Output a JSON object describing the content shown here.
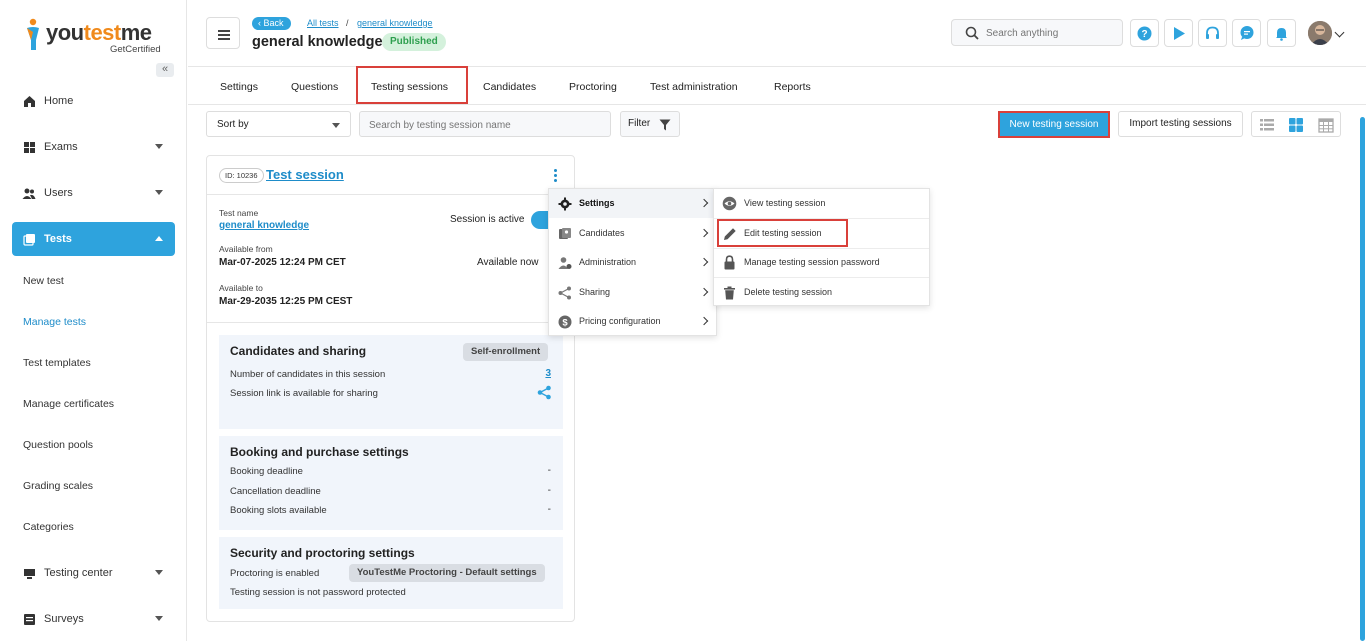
{
  "brand": {
    "name_part1": "you",
    "name_part2": "test",
    "name_part3": "me",
    "tagline": "GetCertified",
    "accent": "#f08a1c"
  },
  "sidebar": {
    "items": [
      {
        "label": "Home",
        "icon": "home-icon"
      },
      {
        "label": "Exams",
        "icon": "exams-icon"
      },
      {
        "label": "Users",
        "icon": "users-icon"
      },
      {
        "label": "Tests",
        "icon": "tests-icon"
      },
      {
        "label": "Testing center",
        "icon": "testing-center-icon"
      },
      {
        "label": "Surveys",
        "icon": "surveys-icon"
      }
    ],
    "sub_items": [
      "New test",
      "Manage tests",
      "Test templates",
      "Manage certificates",
      "Question pools",
      "Grading scales",
      "Categories"
    ]
  },
  "header": {
    "back_label": "Back",
    "breadcrumb": [
      "All tests",
      "general knowledge"
    ],
    "breadcrumb_sep": "/",
    "title": "general knowledge",
    "status": "Published",
    "search_placeholder": "Search anything",
    "icons": [
      "help-icon",
      "play-icon",
      "support-icon",
      "chat-icon",
      "notifications-icon"
    ]
  },
  "tabs": [
    "Settings",
    "Questions",
    "Testing sessions",
    "Candidates",
    "Proctoring",
    "Test administration",
    "Reports"
  ],
  "active_tab": "Testing sessions",
  "toolbar": {
    "sort_label": "Sort by",
    "search_placeholder": "Search by testing session name",
    "filter_label": "Filter",
    "new_session_label": "New testing session",
    "import_label": "Import testing sessions",
    "views": [
      "list-view-icon",
      "grid-view-icon",
      "calendar-view-icon"
    ]
  },
  "session": {
    "id_label": "ID: 10236",
    "name": "Test session",
    "test_name_label": "Test name",
    "test_name": "general knowledge",
    "active_label": "Session is active",
    "available_from_label": "Available from",
    "available_from": "Mar-07-2025 12:24 PM CET",
    "available_now": "Available now",
    "available_to_label": "Available to",
    "available_to": "Mar-29-2035 12:25 PM CEST",
    "candidates_section": {
      "title": "Candidates and sharing",
      "badge": "Self-enrollment",
      "count_label": "Number of candidates in this session",
      "count": "3",
      "link_label": "Session link is available for sharing"
    },
    "booking_section": {
      "title": "Booking and purchase settings",
      "rows": [
        {
          "label": "Booking deadline",
          "value": "-"
        },
        {
          "label": "Cancellation deadline",
          "value": "-"
        },
        {
          "label": "Booking slots available",
          "value": "-"
        }
      ]
    },
    "security_section": {
      "title": "Security and proctoring settings",
      "proctoring_label": "Proctoring is enabled",
      "proctoring_badge": "YouTestMe Proctoring - Default settings",
      "password_label": "Testing session is not password protected"
    }
  },
  "context_menu": {
    "items": [
      {
        "label": "Settings",
        "icon": "gear-icon"
      },
      {
        "label": "Candidates",
        "icon": "candidates-icon"
      },
      {
        "label": "Administration",
        "icon": "administration-icon"
      },
      {
        "label": "Sharing",
        "icon": "share-icon"
      },
      {
        "label": "Pricing configuration",
        "icon": "dollar-icon"
      }
    ],
    "submenu": [
      {
        "label": "View testing session",
        "icon": "eye-icon"
      },
      {
        "label": "Edit testing session",
        "icon": "pencil-icon"
      },
      {
        "label": "Manage testing session password",
        "icon": "lock-icon"
      },
      {
        "label": "Delete testing session",
        "icon": "trash-icon"
      }
    ]
  },
  "colors": {
    "primary": "#2ea3dd",
    "highlight": "#d9403a",
    "published_bg": "#d4f1dc",
    "published_text": "#2e9f4f"
  }
}
